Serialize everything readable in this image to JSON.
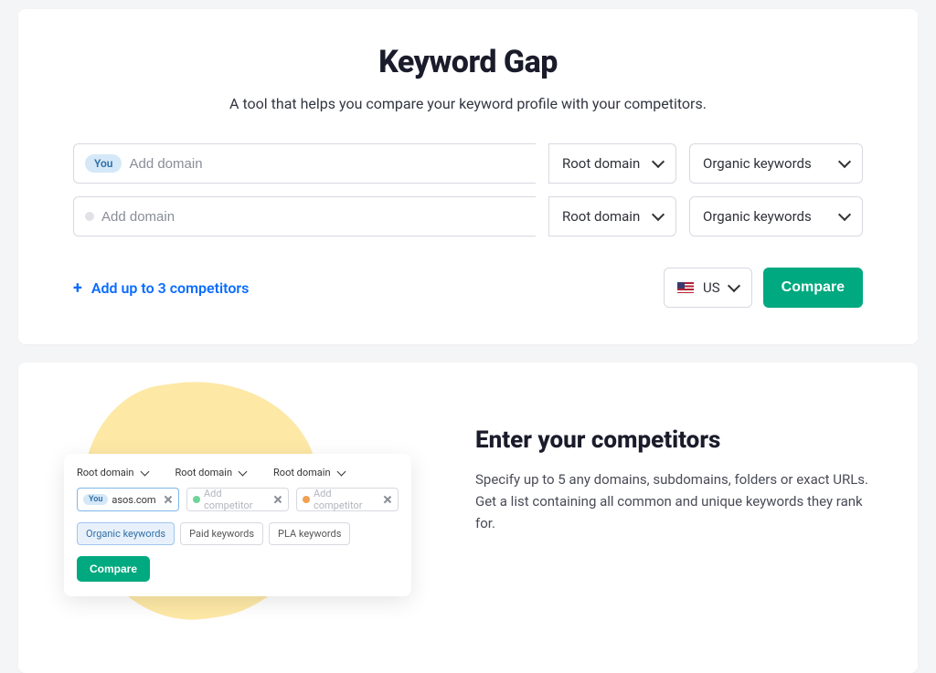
{
  "header": {
    "title": "Keyword Gap",
    "subtitle": "A tool that helps you compare your keyword profile with your competitors."
  },
  "rows": [
    {
      "badge": "You",
      "placeholder": "Add domain",
      "scope": "Root domain",
      "kw": "Organic keywords"
    },
    {
      "badge": null,
      "placeholder": "Add domain",
      "scope": "Root domain",
      "kw": "Organic keywords"
    }
  ],
  "add_link": "Add up to 3 competitors",
  "country": {
    "code": "US"
  },
  "compare_label": "Compare",
  "illustration": {
    "scopes": [
      "Root domain",
      "Root domain",
      "Root domain"
    ],
    "fields": [
      {
        "you": true,
        "value": "asos.com"
      },
      {
        "color": "green",
        "placeholder": "Add competitor"
      },
      {
        "color": "orange",
        "placeholder": "Add competitor"
      }
    ],
    "tabs": [
      "Organic keywords",
      "Paid keywords",
      "PLA keywords"
    ],
    "active_tab": 0,
    "compare": "Compare",
    "you_label": "You"
  },
  "info": {
    "heading": "Enter your competitors",
    "body": "Specify up to 5 any domains, subdomains, folders or exact URLs. Get a list containing all common and unique keywords they rank for."
  }
}
